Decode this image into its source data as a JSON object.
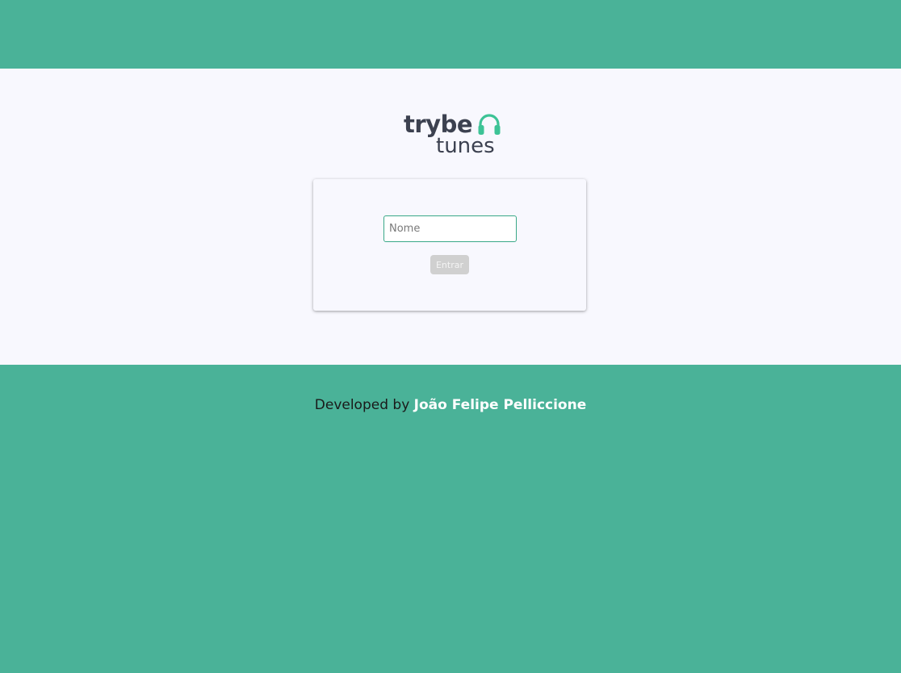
{
  "brand": {
    "logo_line1": "trybe",
    "logo_line2": "tunes",
    "logo_icon": "headphones-icon",
    "colors": {
      "accent": "#4ab298",
      "logo_text": "#3c4150",
      "page_bg": "#f8f8fe"
    }
  },
  "login": {
    "name_placeholder": "Nome",
    "name_value": "",
    "submit_label": "Entrar",
    "submit_disabled": true
  },
  "footer": {
    "credit_prefix": "Developed by",
    "author": "João Felipe Pelliccione"
  }
}
